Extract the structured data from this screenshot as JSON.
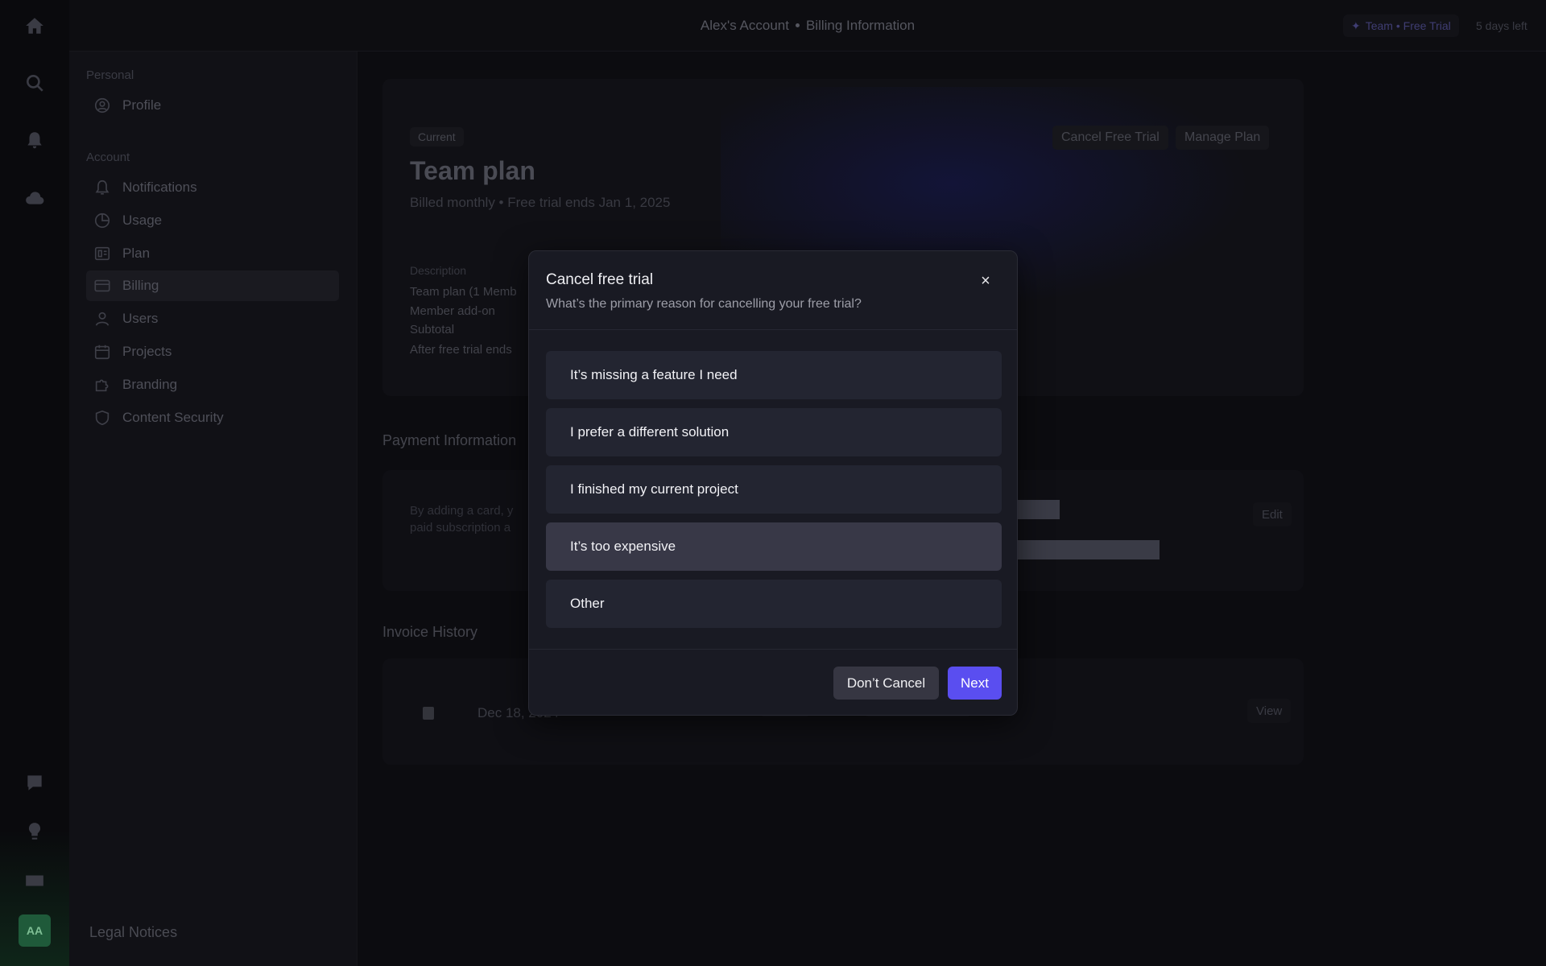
{
  "header": {
    "account": "Alex's Account",
    "page": "Billing Information",
    "trial_badge": "Team • Free Trial",
    "days_left": "5 days left"
  },
  "rail": {
    "icons": [
      "home-icon",
      "search-icon",
      "bell-icon",
      "cloud-upload-icon",
      "help-icon",
      "lightbulb-icon",
      "keyboard-icon"
    ],
    "avatar_initials": "AA"
  },
  "sidebar": {
    "personal_label": "Personal",
    "account_label": "Account",
    "items": [
      {
        "label": "Profile",
        "icon": "profile-icon"
      },
      {
        "label": "Notifications",
        "icon": "bell-icon"
      },
      {
        "label": "Usage",
        "icon": "pie-chart-icon"
      },
      {
        "label": "Plan",
        "icon": "plan-icon"
      },
      {
        "label": "Billing",
        "icon": "credit-card-icon"
      },
      {
        "label": "Users",
        "icon": "user-icon"
      },
      {
        "label": "Projects",
        "icon": "calendar-icon"
      },
      {
        "label": "Branding",
        "icon": "puzzle-icon"
      },
      {
        "label": "Content Security",
        "icon": "shield-icon"
      }
    ],
    "active": "Billing",
    "legal": "Legal Notices"
  },
  "plan": {
    "badge": "Current",
    "title": "Team plan",
    "subtitle": "Billed monthly • Free trial ends Jan 1, 2025",
    "cancel_button": "Cancel Free Trial",
    "manage_button": "Manage Plan",
    "description_label": "Description",
    "description_lines": [
      "Team plan (1 Memb",
      "Member add-on",
      "Subtotal",
      "After free trial ends"
    ]
  },
  "payment": {
    "title": "Payment Information",
    "text_line1": "By adding a card, y",
    "text_line2": "paid subscription a",
    "edit_button": "Edit"
  },
  "invoices": {
    "title": "Invoice History",
    "date": "Dec 18, 2024",
    "view_button": "View"
  },
  "modal": {
    "title": "Cancel free trial",
    "subtitle": "What’s the primary reason for cancelling your free trial?",
    "close": "×",
    "options": [
      "It’s missing a feature I need",
      "I prefer a different solution",
      "I finished my current project",
      "It’s too expensive",
      "Other"
    ],
    "selected": "It’s too expensive",
    "dont_cancel": "Don’t Cancel",
    "next": "Next"
  },
  "colors": {
    "accent": "#5a4ef0",
    "modal_bg": "#191a23",
    "option_bg": "#232531",
    "option_selected_bg": "#383847"
  }
}
